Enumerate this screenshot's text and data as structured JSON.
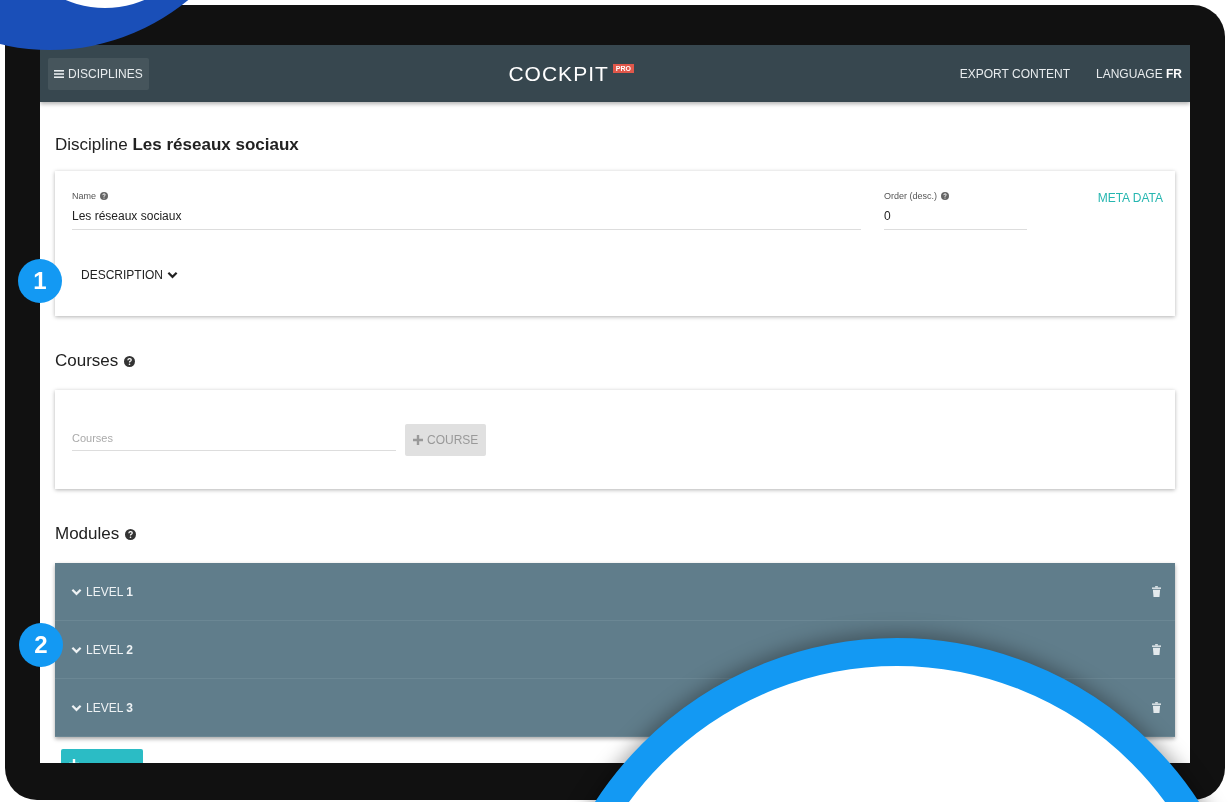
{
  "navbar": {
    "menu_button": "DISCIPLINES",
    "logo": "COCKPIT",
    "logo_badge": "PRO",
    "links": [
      {
        "label": "EXPORT CONTENT"
      },
      {
        "label": "LANGUAGE **FR**"
      }
    ]
  },
  "heading": "Discipline **Les réseaux sociaux**",
  "discipline_form": {
    "fields": [
      {
        "label": "Name",
        "value": "Les réseaux sociaux"
      },
      {
        "label": "Order (desc.)",
        "value": "0"
      }
    ],
    "meta_link": "META DATA",
    "description_toggle": "DESCRIPTION"
  },
  "courses": {
    "title": "Courses",
    "placeholder": "Courses",
    "add_button": "COURSE",
    "disabled": true
  },
  "modules": {
    "title": "Modules",
    "items": [
      {
        "label": "LEVEL **1**"
      },
      {
        "label": "LEVEL **2**"
      },
      {
        "label": "LEVEL **3**"
      }
    ]
  },
  "callouts": [
    "1",
    "2"
  ]
}
